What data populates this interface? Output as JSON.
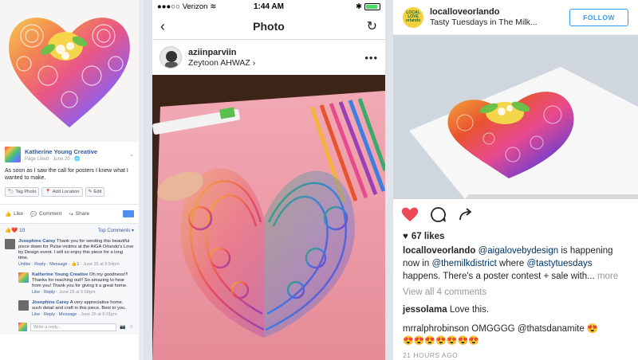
{
  "facebook": {
    "author": "Katherine Young Creative",
    "meta": "Page Liked · June 20 · ",
    "post_text": "As soon as I saw the call for posters I knew what I wanted to make.",
    "tag_photo": "Tag Photo",
    "add_location": "Add Location",
    "edit": "Edit",
    "like": "Like",
    "comment": "Comment",
    "share": "Share",
    "reaction_count": "10",
    "top_comments": "Top Comments ▾",
    "comments": [
      {
        "name": "Josephine Carey",
        "text": " Thank you for sending this beautiful piece down for Pulse victims at the AIGA Orlando's Love by Design event. I will so enjoy this piece for a long time.",
        "links": "Unlike · Reply · Message · ",
        "likes": "1",
        "time": " · June 26 at 5:54pm"
      },
      {
        "name": "Katherine Young Creative",
        "text": " Oh my goodness!!! Thanks for reaching out!! So amazing to hear from you! Thank you for giving it a great home.",
        "links": "Like · Reply · ",
        "time": "June 26 at 5:58pm"
      },
      {
        "name": "Josephine Carey",
        "text": " A very appreciative home, such detail and craft in this piece. Best to you.",
        "links": "Like · Reply · Message · ",
        "time": "June 26 at 6:01pm"
      }
    ],
    "write_placeholder": "Write a reply..."
  },
  "phone": {
    "carrier": "Verizon",
    "time": "1:44 AM",
    "title": "Photo",
    "username": "aziinparviin",
    "location": "Zeytoon AHWAZ",
    "battery_level": 0.9
  },
  "web": {
    "avatar_text": "LOCAL LOVE orlando",
    "username": "localloveorlando",
    "location": "Tasty Tuesdays in The Milk...",
    "follow": "FOLLOW",
    "likes": "67 likes",
    "caption_user": "localloveorlando",
    "caption_m1": "@aigalovebydesign",
    "caption_t1": " is happening now in ",
    "caption_m2": "@themilkdistrict",
    "caption_t2": " where ",
    "caption_m3": "@tastytuesdays",
    "caption_t3": " happens. There's a poster contest + sale with...",
    "caption_more": " more",
    "view_all": "View all 4 comments",
    "comment1_user": "jessolama",
    "comment1_text": " Love this.",
    "comment2_user": "mrralphrobinson",
    "comment2_text": " OMGGGG ",
    "comment2_mention": "@thatsdanamite",
    "comment2_emoji": " 😍",
    "emoji_row": "😍😍😍😍😍😍😍",
    "age": "21 HOURS AGO",
    "colors": {
      "accent": "#3897f0",
      "heart": "#ed4956"
    }
  }
}
